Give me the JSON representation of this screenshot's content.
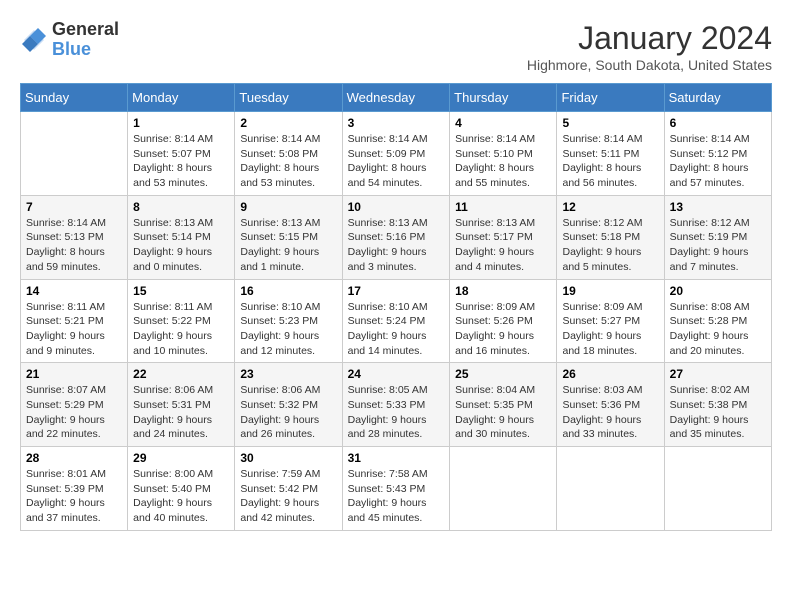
{
  "header": {
    "logo_text_general": "General",
    "logo_text_blue": "Blue",
    "title": "January 2024",
    "subtitle": "Highmore, South Dakota, United States"
  },
  "days_of_week": [
    "Sunday",
    "Monday",
    "Tuesday",
    "Wednesday",
    "Thursday",
    "Friday",
    "Saturday"
  ],
  "weeks": [
    [
      {
        "day": "",
        "sunrise": "",
        "sunset": "",
        "daylight": ""
      },
      {
        "day": "1",
        "sunrise": "Sunrise: 8:14 AM",
        "sunset": "Sunset: 5:07 PM",
        "daylight": "Daylight: 8 hours and 53 minutes."
      },
      {
        "day": "2",
        "sunrise": "Sunrise: 8:14 AM",
        "sunset": "Sunset: 5:08 PM",
        "daylight": "Daylight: 8 hours and 53 minutes."
      },
      {
        "day": "3",
        "sunrise": "Sunrise: 8:14 AM",
        "sunset": "Sunset: 5:09 PM",
        "daylight": "Daylight: 8 hours and 54 minutes."
      },
      {
        "day": "4",
        "sunrise": "Sunrise: 8:14 AM",
        "sunset": "Sunset: 5:10 PM",
        "daylight": "Daylight: 8 hours and 55 minutes."
      },
      {
        "day": "5",
        "sunrise": "Sunrise: 8:14 AM",
        "sunset": "Sunset: 5:11 PM",
        "daylight": "Daylight: 8 hours and 56 minutes."
      },
      {
        "day": "6",
        "sunrise": "Sunrise: 8:14 AM",
        "sunset": "Sunset: 5:12 PM",
        "daylight": "Daylight: 8 hours and 57 minutes."
      }
    ],
    [
      {
        "day": "7",
        "sunrise": "Sunrise: 8:14 AM",
        "sunset": "Sunset: 5:13 PM",
        "daylight": "Daylight: 8 hours and 59 minutes."
      },
      {
        "day": "8",
        "sunrise": "Sunrise: 8:13 AM",
        "sunset": "Sunset: 5:14 PM",
        "daylight": "Daylight: 9 hours and 0 minutes."
      },
      {
        "day": "9",
        "sunrise": "Sunrise: 8:13 AM",
        "sunset": "Sunset: 5:15 PM",
        "daylight": "Daylight: 9 hours and 1 minute."
      },
      {
        "day": "10",
        "sunrise": "Sunrise: 8:13 AM",
        "sunset": "Sunset: 5:16 PM",
        "daylight": "Daylight: 9 hours and 3 minutes."
      },
      {
        "day": "11",
        "sunrise": "Sunrise: 8:13 AM",
        "sunset": "Sunset: 5:17 PM",
        "daylight": "Daylight: 9 hours and 4 minutes."
      },
      {
        "day": "12",
        "sunrise": "Sunrise: 8:12 AM",
        "sunset": "Sunset: 5:18 PM",
        "daylight": "Daylight: 9 hours and 5 minutes."
      },
      {
        "day": "13",
        "sunrise": "Sunrise: 8:12 AM",
        "sunset": "Sunset: 5:19 PM",
        "daylight": "Daylight: 9 hours and 7 minutes."
      }
    ],
    [
      {
        "day": "14",
        "sunrise": "Sunrise: 8:11 AM",
        "sunset": "Sunset: 5:21 PM",
        "daylight": "Daylight: 9 hours and 9 minutes."
      },
      {
        "day": "15",
        "sunrise": "Sunrise: 8:11 AM",
        "sunset": "Sunset: 5:22 PM",
        "daylight": "Daylight: 9 hours and 10 minutes."
      },
      {
        "day": "16",
        "sunrise": "Sunrise: 8:10 AM",
        "sunset": "Sunset: 5:23 PM",
        "daylight": "Daylight: 9 hours and 12 minutes."
      },
      {
        "day": "17",
        "sunrise": "Sunrise: 8:10 AM",
        "sunset": "Sunset: 5:24 PM",
        "daylight": "Daylight: 9 hours and 14 minutes."
      },
      {
        "day": "18",
        "sunrise": "Sunrise: 8:09 AM",
        "sunset": "Sunset: 5:26 PM",
        "daylight": "Daylight: 9 hours and 16 minutes."
      },
      {
        "day": "19",
        "sunrise": "Sunrise: 8:09 AM",
        "sunset": "Sunset: 5:27 PM",
        "daylight": "Daylight: 9 hours and 18 minutes."
      },
      {
        "day": "20",
        "sunrise": "Sunrise: 8:08 AM",
        "sunset": "Sunset: 5:28 PM",
        "daylight": "Daylight: 9 hours and 20 minutes."
      }
    ],
    [
      {
        "day": "21",
        "sunrise": "Sunrise: 8:07 AM",
        "sunset": "Sunset: 5:29 PM",
        "daylight": "Daylight: 9 hours and 22 minutes."
      },
      {
        "day": "22",
        "sunrise": "Sunrise: 8:06 AM",
        "sunset": "Sunset: 5:31 PM",
        "daylight": "Daylight: 9 hours and 24 minutes."
      },
      {
        "day": "23",
        "sunrise": "Sunrise: 8:06 AM",
        "sunset": "Sunset: 5:32 PM",
        "daylight": "Daylight: 9 hours and 26 minutes."
      },
      {
        "day": "24",
        "sunrise": "Sunrise: 8:05 AM",
        "sunset": "Sunset: 5:33 PM",
        "daylight": "Daylight: 9 hours and 28 minutes."
      },
      {
        "day": "25",
        "sunrise": "Sunrise: 8:04 AM",
        "sunset": "Sunset: 5:35 PM",
        "daylight": "Daylight: 9 hours and 30 minutes."
      },
      {
        "day": "26",
        "sunrise": "Sunrise: 8:03 AM",
        "sunset": "Sunset: 5:36 PM",
        "daylight": "Daylight: 9 hours and 33 minutes."
      },
      {
        "day": "27",
        "sunrise": "Sunrise: 8:02 AM",
        "sunset": "Sunset: 5:38 PM",
        "daylight": "Daylight: 9 hours and 35 minutes."
      }
    ],
    [
      {
        "day": "28",
        "sunrise": "Sunrise: 8:01 AM",
        "sunset": "Sunset: 5:39 PM",
        "daylight": "Daylight: 9 hours and 37 minutes."
      },
      {
        "day": "29",
        "sunrise": "Sunrise: 8:00 AM",
        "sunset": "Sunset: 5:40 PM",
        "daylight": "Daylight: 9 hours and 40 minutes."
      },
      {
        "day": "30",
        "sunrise": "Sunrise: 7:59 AM",
        "sunset": "Sunset: 5:42 PM",
        "daylight": "Daylight: 9 hours and 42 minutes."
      },
      {
        "day": "31",
        "sunrise": "Sunrise: 7:58 AM",
        "sunset": "Sunset: 5:43 PM",
        "daylight": "Daylight: 9 hours and 45 minutes."
      },
      {
        "day": "",
        "sunrise": "",
        "sunset": "",
        "daylight": ""
      },
      {
        "day": "",
        "sunrise": "",
        "sunset": "",
        "daylight": ""
      },
      {
        "day": "",
        "sunrise": "",
        "sunset": "",
        "daylight": ""
      }
    ]
  ]
}
